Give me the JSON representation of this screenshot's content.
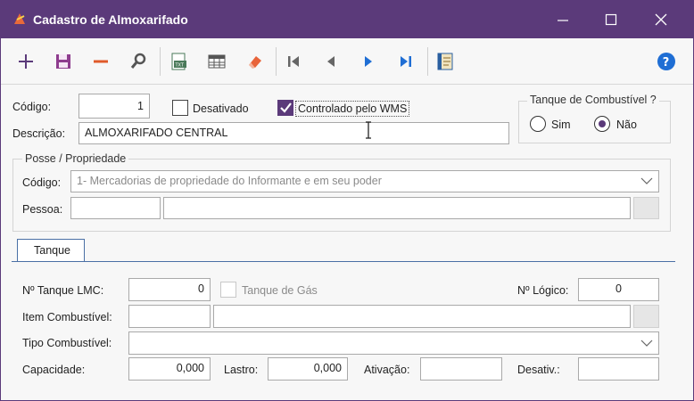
{
  "window": {
    "title": "Cadastro de Almoxarifado"
  },
  "toolbar": {
    "icons": [
      "plus-icon",
      "save-icon",
      "minus-icon",
      "search-icon",
      "report-icon",
      "grid-icon",
      "eraser-icon",
      "first-icon",
      "prev-icon",
      "next-icon",
      "last-icon",
      "notes-icon",
      "help-icon"
    ]
  },
  "header": {
    "codigo_label": "Código:",
    "codigo_value": "1",
    "desativado_label": "Desativado",
    "wms_label": "Controlado pelo WMS",
    "descricao_label": "Descrição:",
    "descricao_value": "ALMOXARIFADO CENTRAL"
  },
  "tanque_combustivel": {
    "title": "Tanque de Combustível ?",
    "sim_label": "Sim",
    "nao_label": "Não",
    "selected": "Não"
  },
  "posse": {
    "title": "Posse / Propriedade",
    "codigo_label": "Código:",
    "codigo_value": "1- Mercadorias de propriedade do Informante e em seu poder",
    "pessoa_label": "Pessoa:"
  },
  "tabs": [
    {
      "label": "Tanque"
    }
  ],
  "tanque": {
    "lmc_label": "Nº Tanque LMC:",
    "lmc_value": "0",
    "gas_label": "Tanque de Gás",
    "logico_label": "Nº Lógico:",
    "logico_value": "0",
    "item_label": "Item Combustível:",
    "tipo_label": "Tipo Combustível:",
    "capacidade_label": "Capacidade:",
    "capacidade_value": "0,000",
    "lastro_label": "Lastro:",
    "lastro_value": "0,000",
    "ativacao_label": "Ativação:",
    "desativ_label": "Desativ.:"
  },
  "colors": {
    "titlebar": "#5b3a7a",
    "accent": "#5b3a7a",
    "tab_border": "#4a6fa5"
  }
}
